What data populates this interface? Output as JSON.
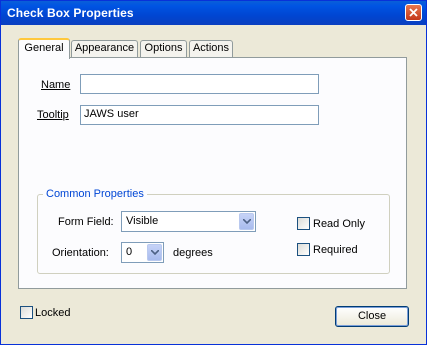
{
  "window": {
    "title": "Check Box Properties"
  },
  "tabs": [
    {
      "label": "General",
      "active": true
    },
    {
      "label": "Appearance",
      "active": false
    },
    {
      "label": "Options",
      "active": false
    },
    {
      "label": "Actions",
      "active": false
    }
  ],
  "general": {
    "name_label": "Name",
    "name_value": "",
    "tooltip_label": "Tooltip",
    "tooltip_value": "JAWS user"
  },
  "common": {
    "title": "Common Properties",
    "form_field_label": "Form Field:",
    "form_field_value": "Visible",
    "orientation_label": "Orientation:",
    "orientation_value": "0",
    "degrees_label": "degrees",
    "read_only_label": "Read Only",
    "read_only_checked": false,
    "required_label": "Required",
    "required_checked": false
  },
  "footer": {
    "locked_label": "Locked",
    "locked_checked": false,
    "close_label": "Close"
  },
  "colors": {
    "titlebar": "#0054e3",
    "accent_tab": "#ffc83c",
    "group_title": "#0046d5"
  }
}
